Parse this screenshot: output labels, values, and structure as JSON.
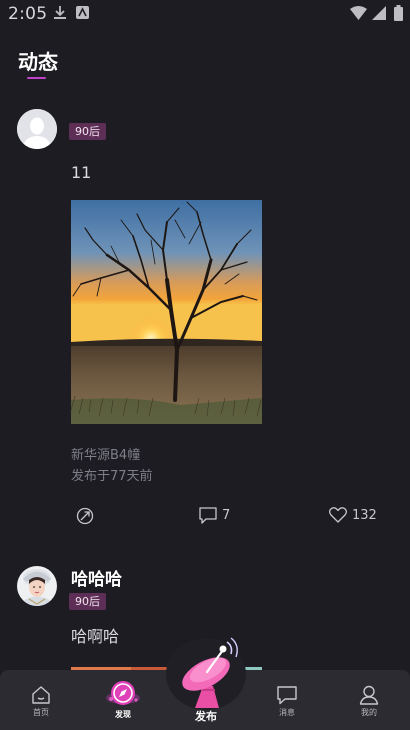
{
  "status_bar": {
    "time": "2:05"
  },
  "header": {
    "title": "动态"
  },
  "posts": [
    {
      "username": "",
      "badge": "90后",
      "text": "11",
      "location": "新华源B4幢",
      "posted": "发布于77天前",
      "comments": "7",
      "likes": "132"
    },
    {
      "username": "哈哈哈",
      "badge": "90后",
      "text": "哈啊哈"
    }
  ],
  "nav": {
    "items": [
      {
        "label": "首页",
        "icon": "home-icon"
      },
      {
        "label": "发现",
        "icon": "compass-icon"
      },
      {
        "label": "发布",
        "icon": "satellite-dish-icon"
      },
      {
        "label": "消息",
        "icon": "chat-icon"
      },
      {
        "label": "我的",
        "icon": "user-icon"
      }
    ]
  },
  "colors": {
    "background": "#1c1c22",
    "accent": "#c040c8",
    "badge": "#5d2f57",
    "nav": "#2b2b31"
  }
}
